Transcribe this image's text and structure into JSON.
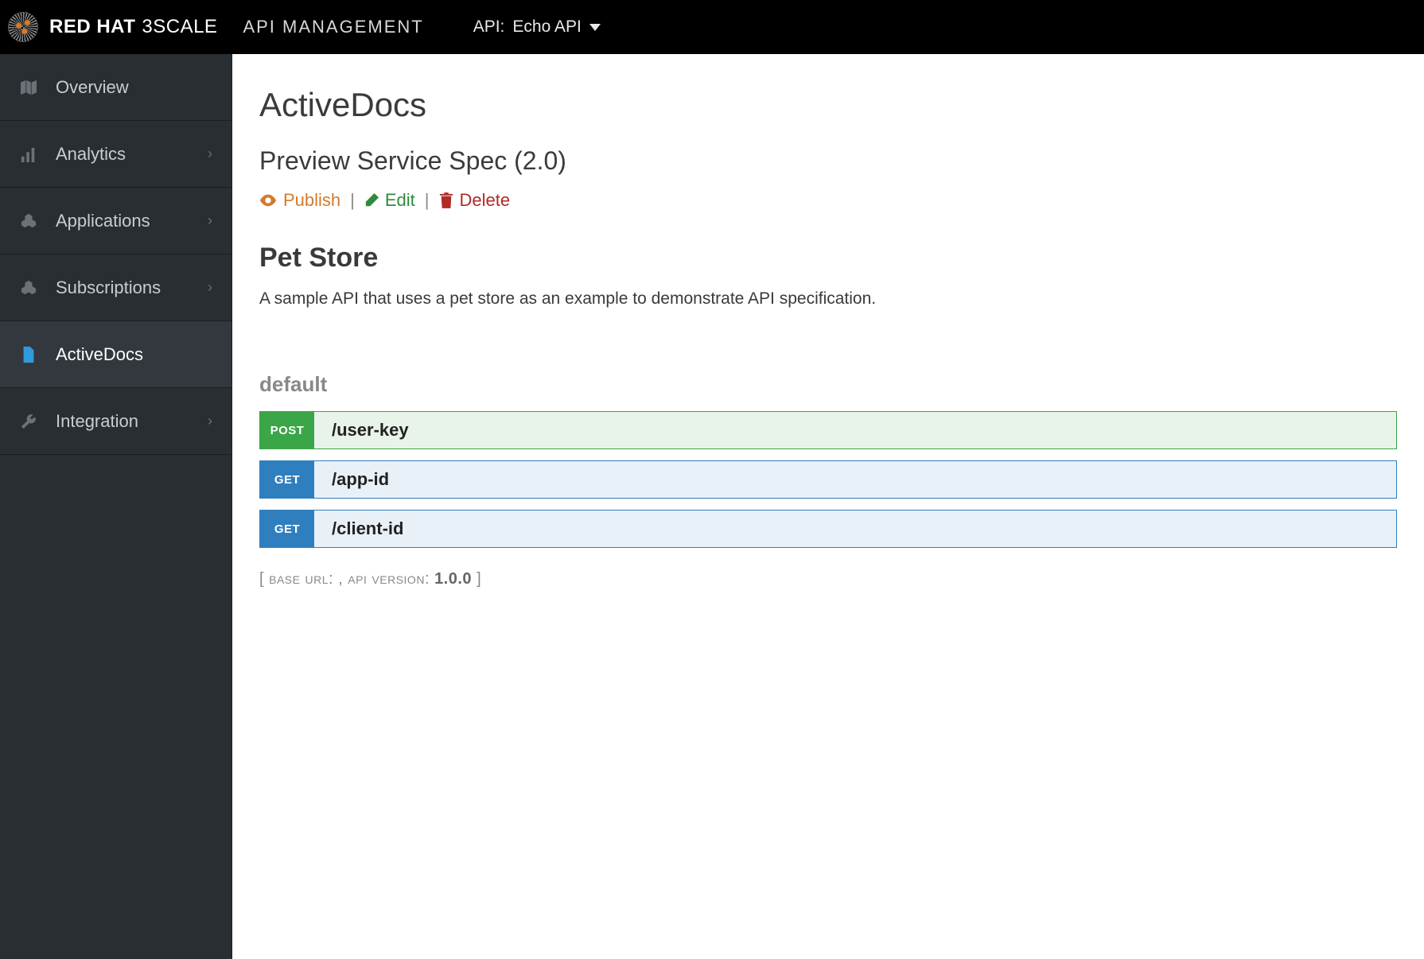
{
  "topbar": {
    "brand_main": "RED HAT",
    "brand_reg": "3SCALE",
    "brand_sub": "API MANAGEMENT",
    "api_selector_prefix": "API:",
    "api_selector_value": "Echo API"
  },
  "sidebar": {
    "items": [
      {
        "id": "overview",
        "label": "Overview",
        "icon": "map-icon",
        "expandable": false,
        "active": false
      },
      {
        "id": "analytics",
        "label": "Analytics",
        "icon": "bars-icon",
        "expandable": true,
        "active": false
      },
      {
        "id": "applications",
        "label": "Applications",
        "icon": "cubes-icon",
        "expandable": true,
        "active": false
      },
      {
        "id": "subscriptions",
        "label": "Subscriptions",
        "icon": "cubes-icon",
        "expandable": true,
        "active": false
      },
      {
        "id": "activedocs",
        "label": "ActiveDocs",
        "icon": "doc-icon",
        "expandable": false,
        "active": true
      },
      {
        "id": "integration",
        "label": "Integration",
        "icon": "wrench-icon",
        "expandable": true,
        "active": false
      }
    ]
  },
  "page": {
    "title": "ActiveDocs",
    "subtitle": "Preview Service Spec (2.0)",
    "actions": {
      "publish": "Publish",
      "edit": "Edit",
      "delete": "Delete"
    }
  },
  "spec": {
    "title": "Pet Store",
    "description": "A sample API that uses a pet store as an example to demonstrate API specification.",
    "tag": "default",
    "operations": [
      {
        "method": "POST",
        "path": "/user-key"
      },
      {
        "method": "GET",
        "path": "/app-id"
      },
      {
        "method": "GET",
        "path": "/client-id"
      }
    ],
    "footer": {
      "bracket_open": "[",
      "base_url_label": "base url",
      "base_url_value": "",
      "sep": ", ",
      "version_label": "api version",
      "version_value": "1.0.0",
      "bracket_close": "]"
    }
  }
}
